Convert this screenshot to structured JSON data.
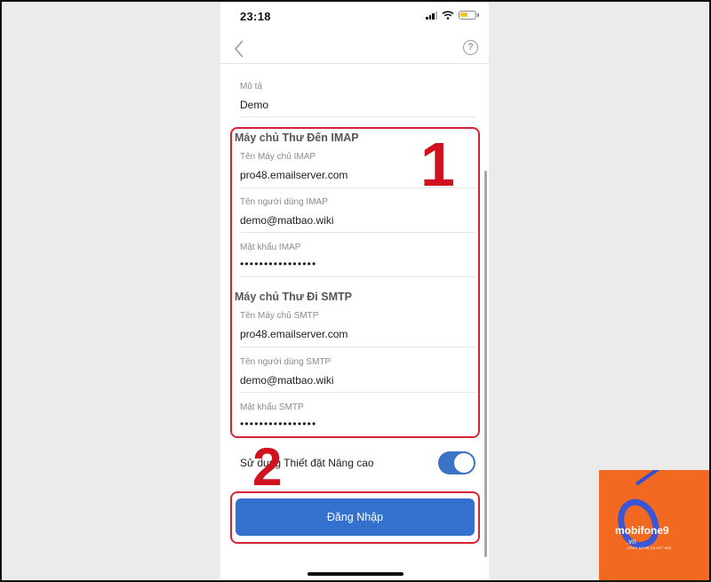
{
  "status_bar": {
    "time": "23:18"
  },
  "description": {
    "label": "Mô tả",
    "value": "Demo"
  },
  "imap": {
    "section_title": "Máy chủ Thư Đến IMAP",
    "host_label": "Tên Máy chủ IMAP",
    "host_value": "pro48.emailserver.com",
    "user_label": "Tên người dùng IMAP",
    "user_value": "demo@matbao.wiki",
    "password_label": "Mật khẩu IMAP",
    "password_value": "••••••••••••••••"
  },
  "smtp": {
    "section_title": "Máy chủ Thư Đi SMTP",
    "host_label": "Tên Máy chủ SMTP",
    "host_value": "pro48.emailserver.com",
    "user_label": "Tên người dùng SMTP",
    "user_value": "demo@matbao.wiki",
    "password_label": "Mật khẩu SMTP",
    "password_value": "••••••••••••••••"
  },
  "advanced": {
    "label": "Sử dụng Thiết đặt Nâng cao",
    "enabled": true
  },
  "login_button": "Đăng Nhập",
  "annotations": {
    "step1": "1",
    "step2": "2"
  },
  "logo": {
    "name": "mobifone9",
    "domain": ".vn",
    "tagline": "CÔNG NGHỆ VÀ KẾT NỐI"
  },
  "colors": {
    "accent": "#3470cd",
    "annotation": "#d62433",
    "logo_bg": "#f26a22"
  }
}
